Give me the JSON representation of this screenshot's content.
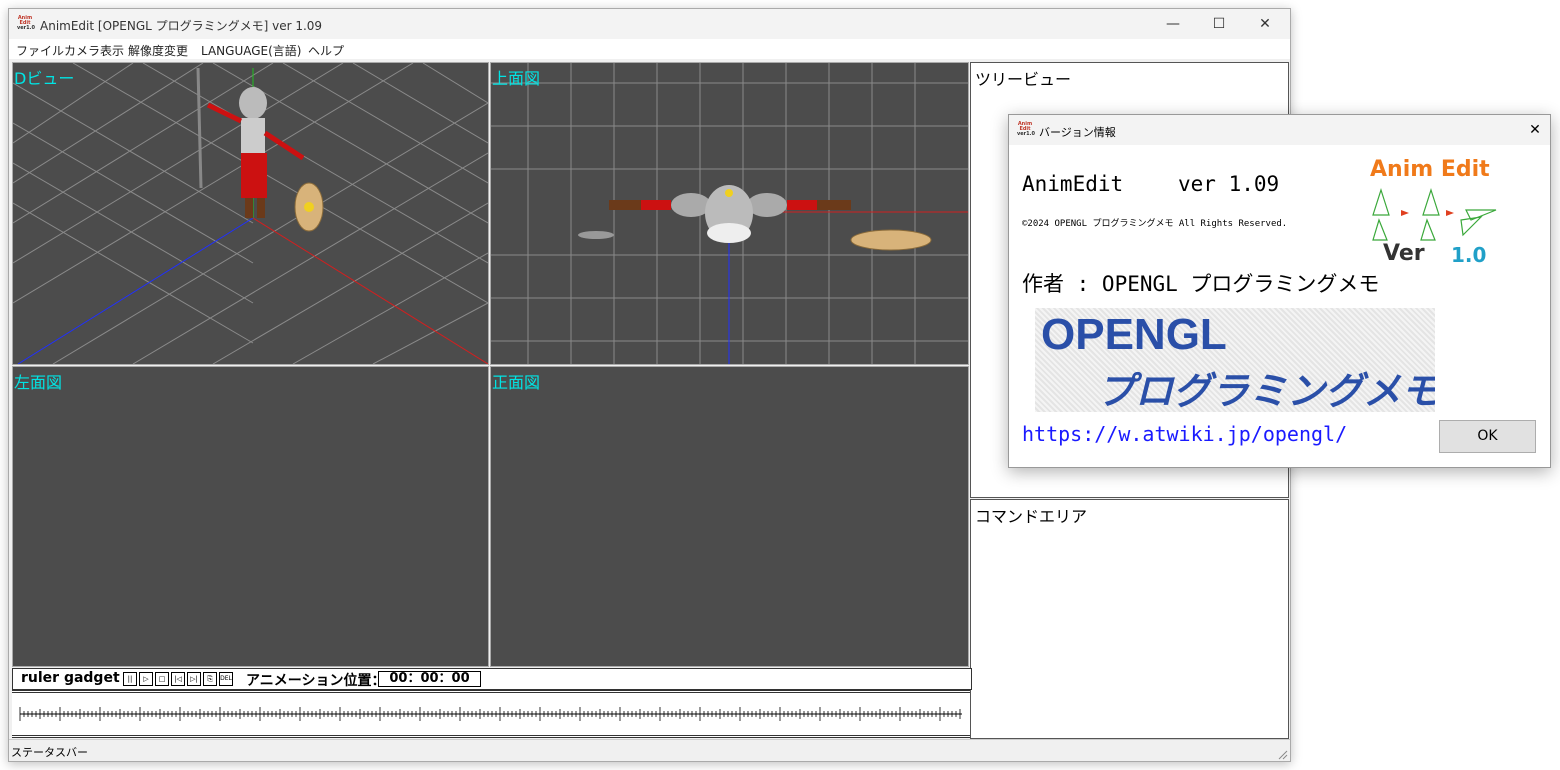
{
  "window": {
    "title": "AnimEdit [OPENGL プログラミングメモ] ver 1.09",
    "icon_text": [
      "Anim",
      "Edit",
      "ver1.0"
    ],
    "controls": {
      "minimize": "—",
      "maximize": "☐",
      "close": "✕"
    }
  },
  "menu": {
    "items": [
      {
        "label": "ファイル"
      },
      {
        "label": "カメラ表示"
      },
      {
        "label": "解像度変更"
      },
      {
        "label": "LANGUAGE(言語)"
      },
      {
        "label": "ヘルプ"
      }
    ]
  },
  "viewports": {
    "perspective": {
      "label": "Dビュー"
    },
    "top": {
      "label": "上面図"
    },
    "left": {
      "label": "左面図"
    },
    "front": {
      "label": "正面図"
    }
  },
  "panels": {
    "tree": {
      "label": "ツリービュー"
    },
    "command": {
      "label": "コマンドエリア"
    }
  },
  "ruler": {
    "label": "ruler gadget",
    "buttons": [
      {
        "name": "pause",
        "glyph": "||"
      },
      {
        "name": "play",
        "glyph": "▷"
      },
      {
        "name": "stop",
        "glyph": "□"
      },
      {
        "name": "first",
        "glyph": "|◁"
      },
      {
        "name": "last",
        "glyph": "▷|"
      },
      {
        "name": "paste",
        "glyph": "⎘"
      },
      {
        "name": "delete",
        "glyph": "DEL"
      }
    ],
    "position_label": "アニメーション位置：",
    "position_value": "00：00：00"
  },
  "statusbar": {
    "text": "ステータスバー"
  },
  "about_dialog": {
    "title": "バージョン情報",
    "close": "✕",
    "app_name": "AnimEdit",
    "version": "ver 1.09",
    "copyright": "©2024 OPENGL プログラミングメモ All Rights Reserved.",
    "author": "作者 : OPENGL プログラミングメモ",
    "logo_line1": "OPENGL",
    "logo_line2": "プログラミングメモ",
    "brand_title": "Anim Edit",
    "brand_ver_label": "Ver",
    "brand_ver_num": "1.0",
    "url": "https://w.atwiki.jp/opengl/",
    "ok": "OK"
  },
  "colors": {
    "viewport_bg": "#4c4c4c",
    "viewport_label": "#00e5e5",
    "brand_orange": "#f07a1a",
    "brand_blue": "#20a0c8",
    "link": "#1a1aff",
    "logo_blue": "#2a4fa8"
  }
}
